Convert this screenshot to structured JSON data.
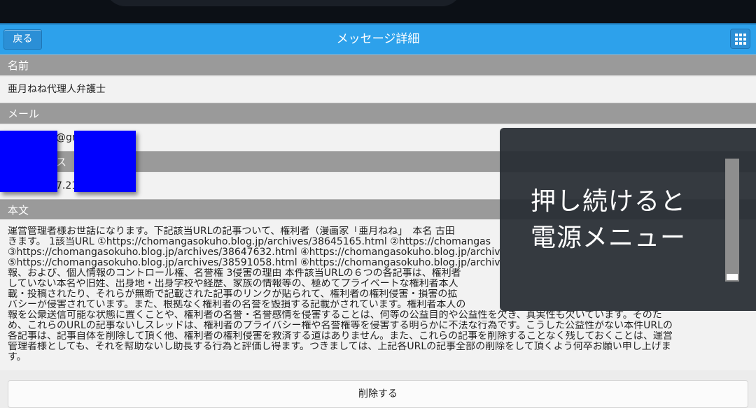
{
  "header": {
    "back_label": "戻る",
    "title": "メッセージ詳細",
    "menu_icon": "grid-icon",
    "color": "#2da1eb"
  },
  "fields": {
    "name_label": "名前",
    "name_value": "亜月ねね代理人弁護士",
    "mail_label": "メール",
    "mail_value_fragment": "@gm",
    "ip_label_fragment": "ス",
    "ip_value_fragment": "7.21",
    "body_label": "本文"
  },
  "body_lines": [
    "運営管理者様お世話になります。下記該当URLの記事ついて、権利者（漫画家「亜月ねね」　本名 古田",
    "きます。 1該当URL ①https://chomangasokuho.blog.jp/archives/38645165.html ②https://chomangas",
    "③https://chomangasokuho.blog.jp/archives/38647632.html ④https://chomangasokuho.blog.jp/archiv",
    "⑤https://chomangasokuho.blog.jp/archives/38591058.html ⑥https://chomangasokuho.blog.jp/archiv",
    "報、および、個人情報のコントロール権、名誉権 3侵害の理由 本件該当URLの６つの各記事は、権利者",
    "していない本名や旧姓、出身地・出身学校や経歴、家族の情報等の、極めてプライベートな権利者本人",
    "載・投稿されたり、それらが無断で記載された記事のリンクが貼られて、権利者の権利侵害・損害の拡",
    "バシーが侵害されています。また、根拠なく権利者の名誉を毀損する記載がされています。権利者本人の",
    "報を公衆送信可能な状態に置くことや、権利者の名誉・名誉感情を侵害することは、何等の公益目的や公益性を欠き、真実性も欠いています。そのた",
    "め、これらのURLの記事ないしスレッドは、権利者のプライバシー権や名誉権等を侵害する明らかに不法な行為です。こうした公益性がない本件URLの",
    "各記事は、記事自体を削除して頂く他、権利者の権利侵害を救済する道はありません。また、これらの記事を削除することなく残しておくことは、運営",
    "管理者様としても、それを幇助ないし助長する行為と評価し得ます。つきましては、上記各URLの記事全部の削除をして頂くよう何卒お願い申し上げま",
    "す。"
  ],
  "delete_label": "削除する",
  "overlay": {
    "line1": "押し続けると",
    "line2": "電源メニュー",
    "progress": 0.05
  },
  "redaction_color": "#0000ff"
}
